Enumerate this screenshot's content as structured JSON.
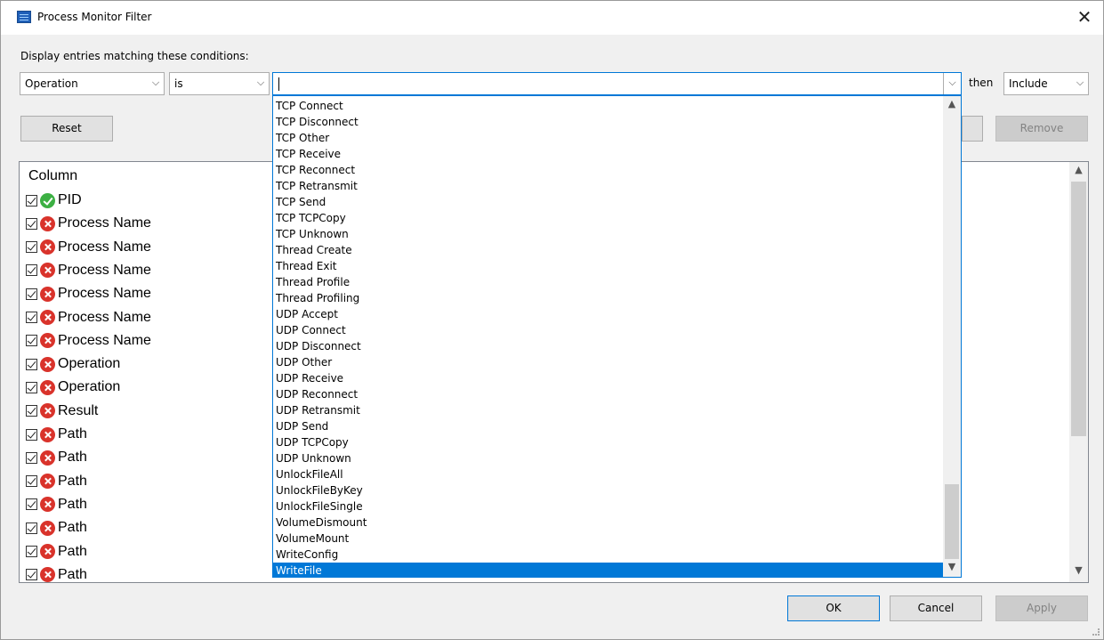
{
  "window": {
    "title": "Process Monitor Filter",
    "close_glyph": "✕",
    "icon": "process-monitor-icon"
  },
  "filter": {
    "prompt": "Display entries matching these conditions:",
    "column_value": "Operation",
    "relation_value": "is",
    "value_text": "",
    "then_label": "then",
    "action_value": "Include",
    "chevron": "⌵"
  },
  "buttons": {
    "reset": "Reset",
    "add": "",
    "remove": "Remove",
    "ok": "OK",
    "cancel": "Cancel",
    "apply": "Apply"
  },
  "list": {
    "header": "Column",
    "rows": [
      {
        "status": "include",
        "label": "PID"
      },
      {
        "status": "exclude",
        "label": "Process Name"
      },
      {
        "status": "exclude",
        "label": "Process Name"
      },
      {
        "status": "exclude",
        "label": "Process Name"
      },
      {
        "status": "exclude",
        "label": "Process Name"
      },
      {
        "status": "exclude",
        "label": "Process Name"
      },
      {
        "status": "exclude",
        "label": "Process Name"
      },
      {
        "status": "exclude",
        "label": "Operation"
      },
      {
        "status": "exclude",
        "label": "Operation"
      },
      {
        "status": "exclude",
        "label": "Result"
      },
      {
        "status": "exclude",
        "label": "Path"
      },
      {
        "status": "exclude",
        "label": "Path"
      },
      {
        "status": "exclude",
        "label": "Path"
      },
      {
        "status": "exclude",
        "label": "Path"
      },
      {
        "status": "exclude",
        "label": "Path"
      },
      {
        "status": "exclude",
        "label": "Path"
      },
      {
        "status": "exclude",
        "label": "Path"
      }
    ]
  },
  "dropdown": {
    "selected": "WriteFile",
    "items": [
      "TCP Connect",
      "TCP Disconnect",
      "TCP Other",
      "TCP Receive",
      "TCP Reconnect",
      "TCP Retransmit",
      "TCP Send",
      "TCP TCPCopy",
      "TCP Unknown",
      "Thread Create",
      "Thread Exit",
      "Thread Profile",
      "Thread Profiling",
      "UDP Accept",
      "UDP Connect",
      "UDP Disconnect",
      "UDP Other",
      "UDP Receive",
      "UDP Reconnect",
      "UDP Retransmit",
      "UDP Send",
      "UDP TCPCopy",
      "UDP Unknown",
      "UnlockFileAll",
      "UnlockFileByKey",
      "UnlockFileSingle",
      "VolumeDismount",
      "VolumeMount",
      "WriteConfig",
      "WriteFile"
    ]
  },
  "colors": {
    "accent": "#0078d7",
    "include": "#3cb043",
    "exclude": "#d9332b"
  }
}
